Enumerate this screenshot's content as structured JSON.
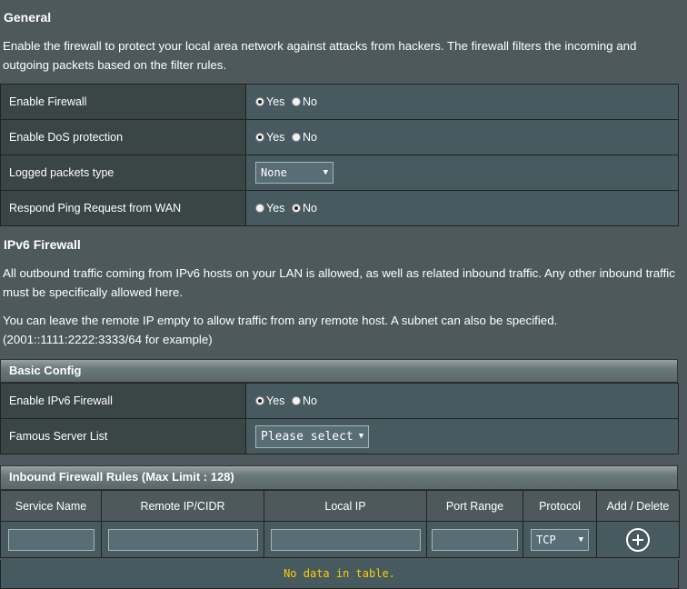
{
  "general": {
    "title": "General",
    "description": "Enable the firewall to protect your local area network against attacks from hackers. The firewall filters the incoming and outgoing packets based on the filter rules.",
    "rows": [
      {
        "label": "Enable Firewall",
        "type": "radio",
        "yes": "Yes",
        "no": "No",
        "selected": "yes"
      },
      {
        "label": "Enable DoS protection",
        "type": "radio",
        "yes": "Yes",
        "no": "No",
        "selected": "yes"
      },
      {
        "label": "Logged packets type",
        "type": "select",
        "value": "None"
      },
      {
        "label": "Respond Ping Request from WAN",
        "type": "radio",
        "yes": "Yes",
        "no": "No",
        "selected": "no"
      }
    ]
  },
  "ipv6": {
    "title": "IPv6 Firewall",
    "para1": "All outbound traffic coming from IPv6 hosts on your LAN is allowed, as well as related inbound traffic. Any other inbound traffic must be specifically allowed here.",
    "para2": "You can leave the remote IP empty to allow traffic from any remote host. A subnet can also be specified. (2001::1111:2222:3333/64 for example)",
    "basic_config": {
      "header": "Basic Config",
      "enable_label": "Enable IPv6 Firewall",
      "yes": "Yes",
      "no": "No",
      "selected": "yes",
      "server_label": "Famous Server List",
      "server_value": "Please select"
    },
    "rules": {
      "header": "Inbound Firewall Rules (Max Limit : 128)",
      "columns": [
        "Service Name",
        "Remote IP/CIDR",
        "Local IP",
        "Port Range",
        "Protocol",
        "Add / Delete"
      ],
      "protocol_value": "TCP",
      "empty_text": "No data in table."
    }
  }
}
